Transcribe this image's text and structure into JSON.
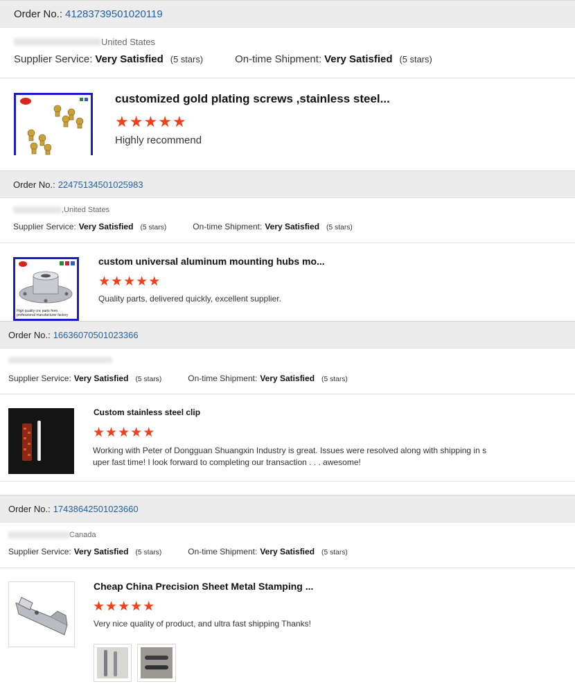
{
  "reviews": [
    {
      "order_label": "Order No.:",
      "order_number": "41283739501020119",
      "buyer_location": "United States",
      "supplier_service_label": "Supplier Service:",
      "supplier_service_value": "Very Satisfied",
      "supplier_service_stars": "(5 stars)",
      "shipment_label": "On-time Shipment:",
      "shipment_value": "Very Satisfied",
      "shipment_stars": "(5 stars)",
      "product_title": "customized gold plating screws ,stainless steel...",
      "rating": 5,
      "comment": "Highly recommend"
    },
    {
      "order_label": "Order No.:",
      "order_number": "22475134501025983",
      "buyer_location": ",United States",
      "supplier_service_label": "Supplier Service:",
      "supplier_service_value": "Very Satisfied",
      "supplier_service_stars": "(5 stars)",
      "shipment_label": "On-time Shipment:",
      "shipment_value": "Very Satisfied",
      "shipment_stars": "(5 stars)",
      "product_title": "custom universal aluminum mounting hubs mo...",
      "rating": 5,
      "comment": "Quality parts, delivered quickly, excellent supplier.",
      "thumb_caption": "High quality cnc parts from professional manufacturer factory"
    },
    {
      "order_label": "Order No.:",
      "order_number": "16636070501023366",
      "buyer_location": "",
      "supplier_service_label": "Supplier Service:",
      "supplier_service_value": "Very Satisfied",
      "supplier_service_stars": "(5 stars)",
      "shipment_label": "On-time Shipment:",
      "shipment_value": "Very Satisfied",
      "shipment_stars": "(5 stars)",
      "product_title": "Custom stainless steel clip",
      "rating": 5,
      "comment_line1": "Working with Peter of Dongguan Shuangxin Industry is great. Issues were resolved along with shipping in s",
      "comment_line2": "uper fast time! I look forward to completing our transaction . . . awesome!"
    },
    {
      "order_label": "Order No.:",
      "order_number": "17438642501023660",
      "buyer_location": "Canada",
      "supplier_service_label": "Supplier Service:",
      "supplier_service_value": "Very Satisfied",
      "supplier_service_stars": "(5 stars)",
      "shipment_label": "On-time Shipment:",
      "shipment_value": "Very Satisfied",
      "shipment_stars": "(5 stars)",
      "product_title": "Cheap China Precision Sheet Metal Stamping ...",
      "rating": 5,
      "comment": "Very nice quality of product, and ultra fast shipping Thanks!"
    }
  ],
  "colors": {
    "order_number": "#1f5fa8",
    "star": "#f0411b",
    "order_bar_bg": "#ececec",
    "thumb_frame": "#1b1bc4"
  },
  "icons": {
    "star": "star-icon",
    "logo_badge": "brand-logo-icon"
  }
}
